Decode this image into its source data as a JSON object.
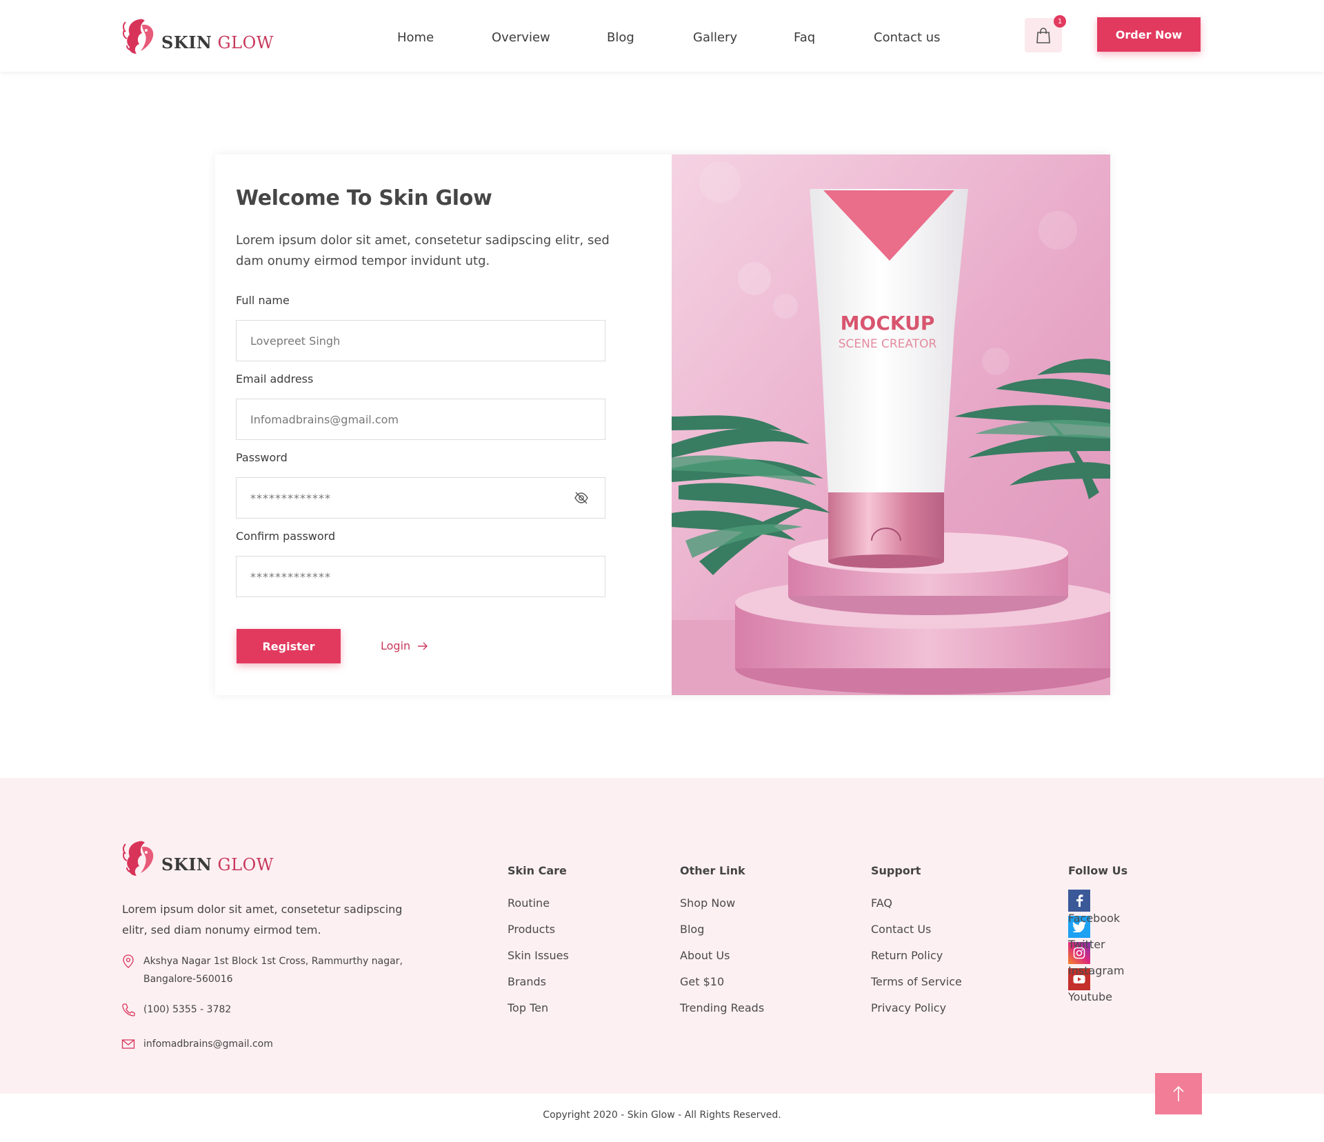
{
  "brand": {
    "name_part1": "SKIN",
    "name_part2": "GLOW",
    "accent_color": "#e23a5f"
  },
  "nav": {
    "items": [
      "Home",
      "Overview",
      "Blog",
      "Gallery",
      "Faq",
      "Contact us"
    ],
    "cart_icon": "shopping-bag-icon",
    "cart_count": "1",
    "order_button": "Order Now"
  },
  "register": {
    "title": "Welcome To Skin Glow",
    "intro": "Lorem ipsum dolor sit amet, consetetur sadipscing elitr, sed dam onumy eirmod tempor invidunt utg.",
    "fields": {
      "full_name": {
        "label": "Full name",
        "value": "Lovepreet Singh"
      },
      "email": {
        "label": "Email address",
        "value": "Infomadbrains@gmail.com"
      },
      "password": {
        "label": "Password",
        "value": "*************"
      },
      "confirm_password": {
        "label": "Confirm password",
        "value": "*************"
      }
    },
    "password_toggle_icon": "eye-off-icon",
    "register_button": "Register",
    "login_link": "Login",
    "login_icon": "arrow-right-icon"
  },
  "hero": {
    "mockup_title": "MOCKUP",
    "mockup_subtitle": "SCENE CREATOR"
  },
  "footer": {
    "about": "Lorem ipsum dolor sit amet, consetetur sadipscing elitr, sed diam nonumy eirmod tem.",
    "address": "Akshya Nagar 1st Block 1st Cross, Rammurthy nagar, Bangalore-560016",
    "phone": "(100) 5355 - 3782",
    "email": "infomadbrains@gmail.com",
    "columns": [
      {
        "title": "Skin Care",
        "links": [
          "Routine",
          "Products",
          "Skin Issues",
          "Brands",
          "Top Ten"
        ]
      },
      {
        "title": "Other Link",
        "links": [
          "Shop Now",
          "Blog",
          "About Us",
          "Get $10",
          "Trending Reads"
        ]
      },
      {
        "title": "Support",
        "links": [
          "FAQ",
          "Contact Us",
          "Return Policy",
          "Terms of Service",
          "Privacy Policy"
        ]
      }
    ],
    "follow": {
      "title": "Follow Us",
      "items": [
        {
          "label": "Facebook",
          "icon": "facebook-icon",
          "color": "#3b5998"
        },
        {
          "label": "Twitter",
          "icon": "twitter-icon",
          "color": "#1da1f2"
        },
        {
          "label": "Instagram",
          "icon": "instagram-icon",
          "color": "#d62976"
        },
        {
          "label": "Youtube",
          "icon": "youtube-icon",
          "color": "#c4302b"
        }
      ]
    },
    "scroll_top_icon": "arrow-up-icon",
    "copyright": "Copyright 2020 - Skin Glow - All Rights Reserved."
  }
}
